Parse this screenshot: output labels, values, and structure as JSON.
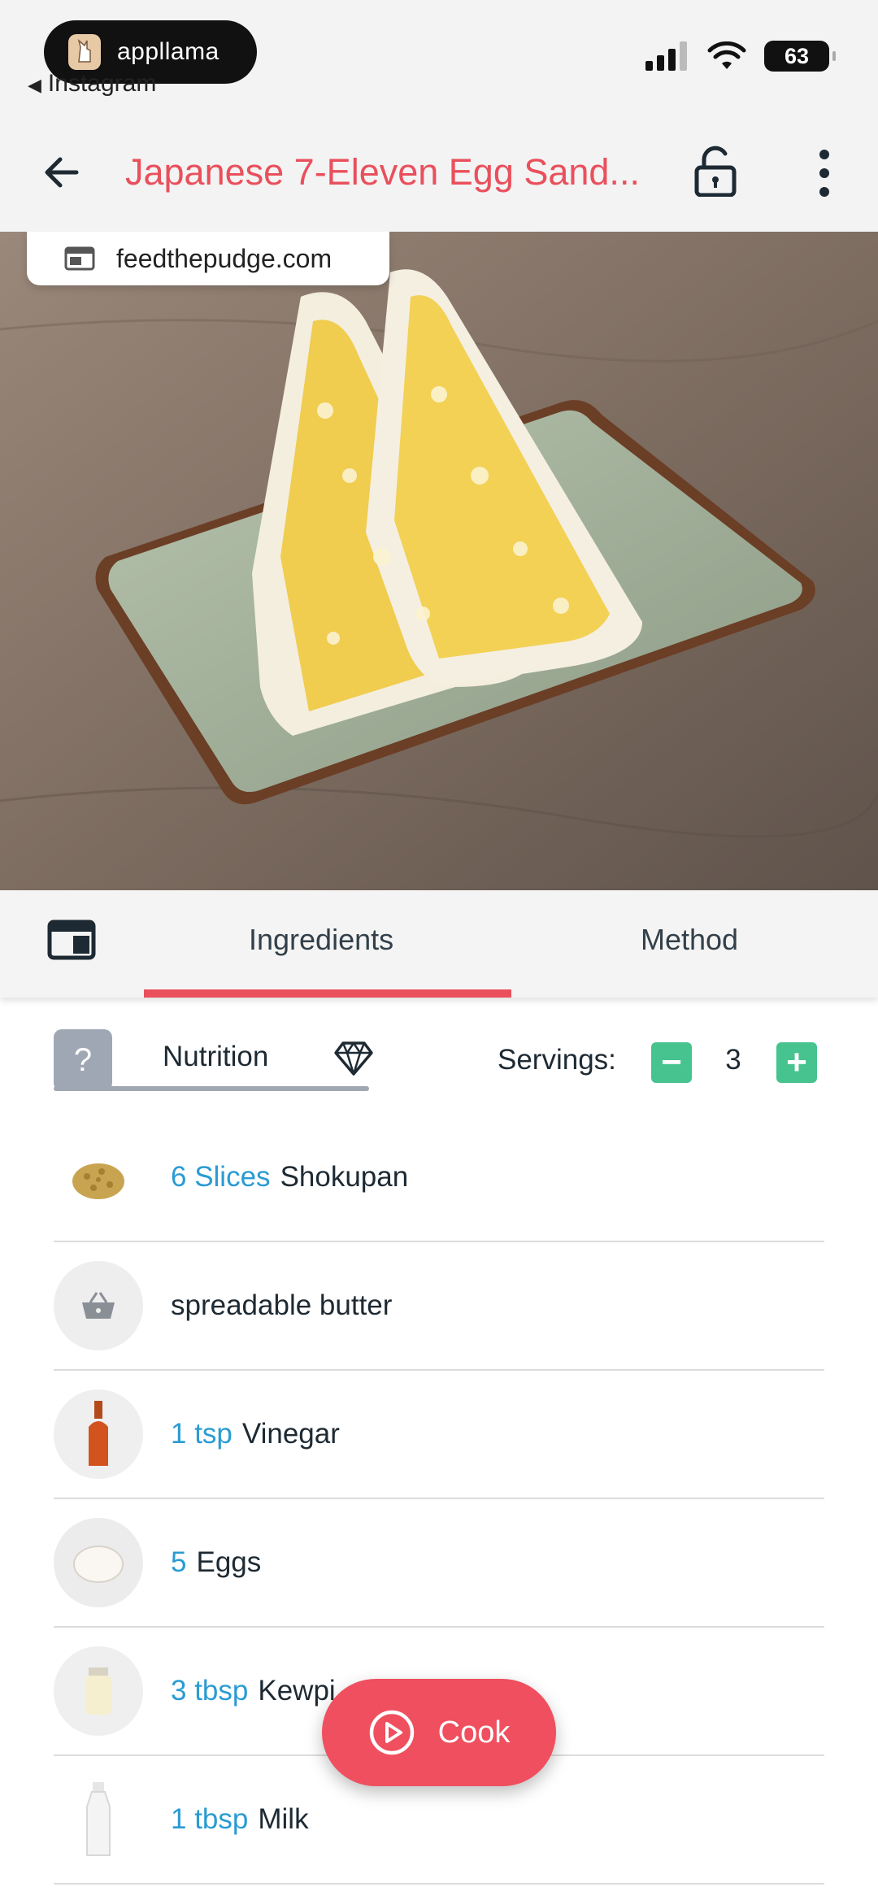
{
  "status_bar": {
    "app_badge": "appllama",
    "back_app": "Instagram",
    "battery": "63"
  },
  "header": {
    "title": "Japanese 7-Eleven Egg Sand..."
  },
  "hero": {
    "source": "feedthepudge.com"
  },
  "tabs": [
    {
      "label": "Ingredients",
      "active": true
    },
    {
      "label": "Method",
      "active": false
    }
  ],
  "nutrition": {
    "help": "?",
    "label": "Nutrition",
    "servings_label": "Servings:",
    "servings": "3",
    "minus": "−",
    "plus": "+"
  },
  "ingredients": [
    {
      "qty": "6 Slices",
      "name": "Shokupan",
      "icon": "bread-crumbs-icon"
    },
    {
      "qty": "",
      "name": "spreadable butter",
      "icon": "basket-icon"
    },
    {
      "qty": "1 tsp",
      "name": "Vinegar",
      "icon": "vinegar-bottle-icon"
    },
    {
      "qty": "5",
      "name": "Eggs",
      "icon": "egg-icon"
    },
    {
      "qty": "3 tbsp",
      "name": "Kewpi",
      "icon": "mayo-jar-icon"
    },
    {
      "qty": "1 tbsp",
      "name": "Milk",
      "icon": "milk-bottle-icon"
    }
  ],
  "cook_button": {
    "label": "Cook"
  },
  "colors": {
    "accent": "#e9505c",
    "quantity": "#2b9bd3",
    "servings_button": "#46c38e"
  }
}
